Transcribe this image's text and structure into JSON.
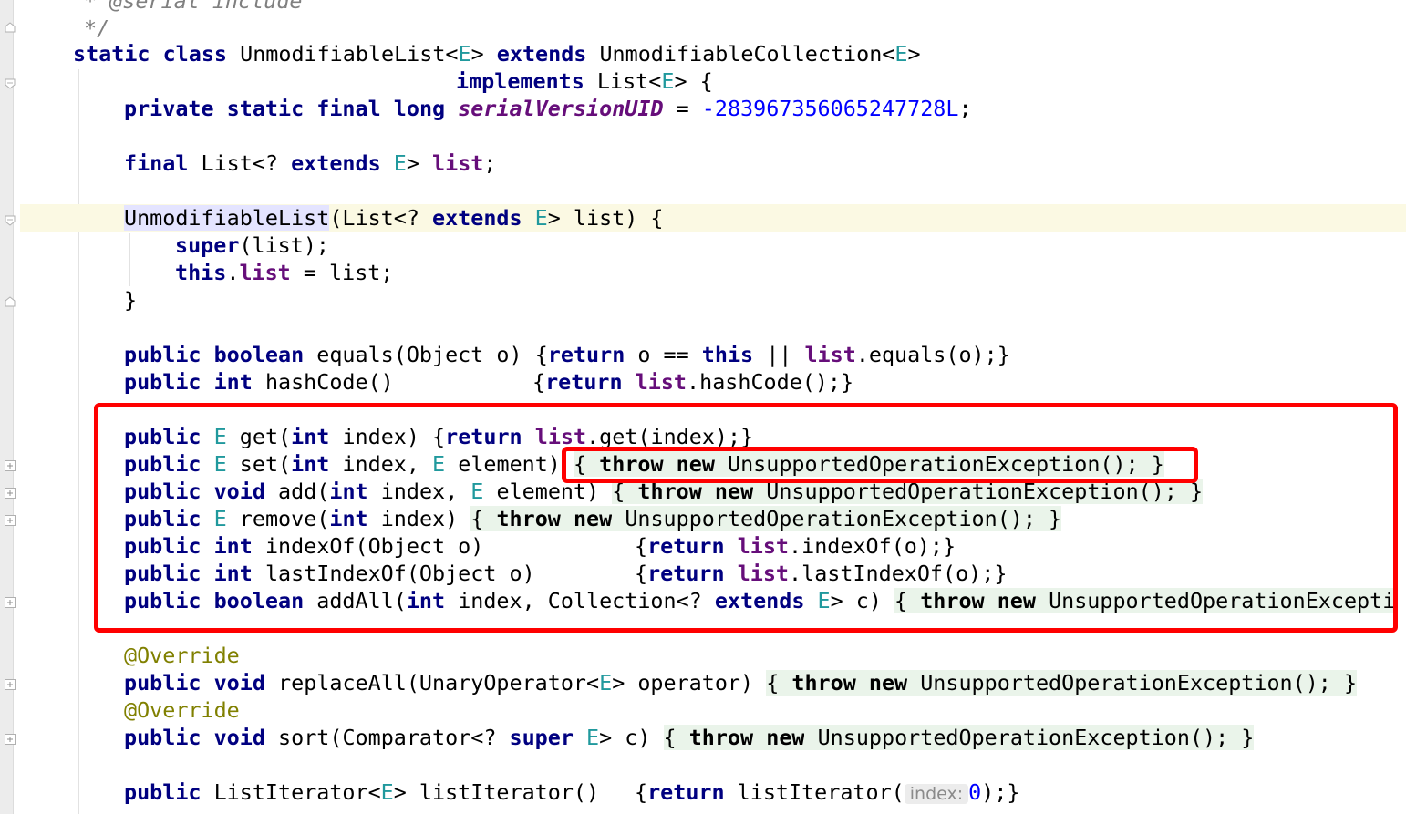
{
  "editor": {
    "comment_1": "* @serial include",
    "comment_2": "*/",
    "l_class_decl": {
      "k1": "static",
      "k2": "class",
      "name": "UnmodifiableList<",
      "tp1": "E",
      "gt1": ">",
      "k3": "extends",
      "sup": "UnmodifiableCollection<",
      "tp2": "E",
      "gt2": ">"
    },
    "l_implements": {
      "k": "implements",
      "list": "List<",
      "tp": "E",
      "rest": "> {"
    },
    "l_serial": {
      "k1": "private",
      "k2": "static",
      "k3": "final",
      "k4": "long",
      "field": "serialVersionUID",
      "eq": " = ",
      "value": "-283967356065247728L",
      "semi": ";"
    },
    "l_field": {
      "k1": "final",
      "t": "List<? ",
      "k2": "extends",
      "tp": "E",
      "gt": "> ",
      "field": "list",
      "semi": ";"
    },
    "l_ctor": {
      "name": "UnmodifiableList",
      "open": "(List<? ",
      "k": "extends",
      "tp": "E",
      "rest": "> list) {"
    },
    "l_super": {
      "k": "super",
      "rest": "(list);"
    },
    "l_this": {
      "k": "this",
      "dot": ".",
      "field": "list",
      "rest": " = list;"
    },
    "l_close": "}",
    "l_equals": {
      "k1": "public",
      "k2": "boolean",
      "sig": "equals(Object o)",
      "b1": "{",
      "k3": "return",
      "mid": " o == ",
      "k4": "this",
      "or": " || ",
      "field": "list",
      "rest": ".equals(o);}"
    },
    "l_hash": {
      "k1": "public",
      "k2": "int",
      "sig": "hashCode()",
      "b1": "{",
      "k3": "return",
      "field": "list",
      "rest": ".hashCode();}"
    },
    "l_get": {
      "k1": "public",
      "tp": "E",
      "m": "get(",
      "k2": "int",
      "p": "index) ",
      "b1": "{",
      "k3": "return",
      "field": "list",
      "rest": ".get(index);}"
    },
    "l_set": {
      "k1": "public",
      "tp": "E",
      "m": "set(",
      "k2": "int",
      "p": "index, ",
      "tp2": "E",
      "p2": "element) ",
      "ob": "{ ",
      "k3": "throw",
      "k4": "new",
      "exc": "UnsupportedOperationException();",
      "cb": " }"
    },
    "l_add": {
      "k1": "public",
      "k2": "void",
      "m": "add(",
      "k3": "int",
      "p": "index, ",
      "tp": "E",
      "p2": "element) ",
      "ob": "{ ",
      "k4": "throw",
      "k5": "new",
      "exc": "UnsupportedOperationException();",
      "cb": " }"
    },
    "l_remove": {
      "k1": "public",
      "tp": "E",
      "m": "remove(",
      "k2": "int",
      "p": "index) ",
      "ob": "{ ",
      "k3": "throw",
      "k4": "new",
      "exc": "UnsupportedOperationException();",
      "cb": " }"
    },
    "l_indexof": {
      "k1": "public",
      "k2": "int",
      "sig": "indexOf(Object o)",
      "b1": "{",
      "k3": "return",
      "field": "list",
      "rest": ".indexOf(o);}"
    },
    "l_lastindexof": {
      "k1": "public",
      "k2": "int",
      "sig": "lastIndexOf(Object o)",
      "b1": "{",
      "k3": "return",
      "field": "list",
      "rest": ".lastIndexOf(o);}"
    },
    "l_addall": {
      "k1": "public",
      "k2": "boolean",
      "m": "addAll(",
      "k3": "int",
      "p": "index, Collection<? ",
      "k4": "extends",
      "tp": "E",
      "p2": "> c) ",
      "ob": "{ ",
      "k5": "throw",
      "k6": "new",
      "exc": "UnsupportedOperationExcepti"
    },
    "l_override1": "@Override",
    "l_replaceall": {
      "k1": "public",
      "k2": "void",
      "m": "replaceAll(UnaryOperator<",
      "tp": "E",
      "p": "> operator) ",
      "ob": "{ ",
      "k3": "throw",
      "k4": "new",
      "exc": "UnsupportedOperationException();",
      "cb": " }"
    },
    "l_override2": "@Override",
    "l_sort": {
      "k1": "public",
      "k2": "void",
      "m": "sort(Comparator<? ",
      "k3": "super",
      "tp": "E",
      "p": "> c) ",
      "ob": "{ ",
      "k4": "throw",
      "k5": "new",
      "exc": "UnsupportedOperationException();",
      "cb": " }"
    },
    "l_listiter": {
      "k1": "public",
      "t": "ListIterator<",
      "tp": "E",
      "m": "> listIterator()",
      "b1": "{",
      "k2": "return",
      "call": " listIterator(",
      "hint": "index:",
      "num": "0",
      "rest": ");}"
    }
  },
  "colors": {
    "keyword": "#000080",
    "type_param": "#20999d",
    "field": "#660e7a",
    "number": "#0000ff",
    "annotation": "#808000",
    "comment": "#808080",
    "highlight_box": "#ff0000",
    "current_line": "#fbf9e3"
  }
}
